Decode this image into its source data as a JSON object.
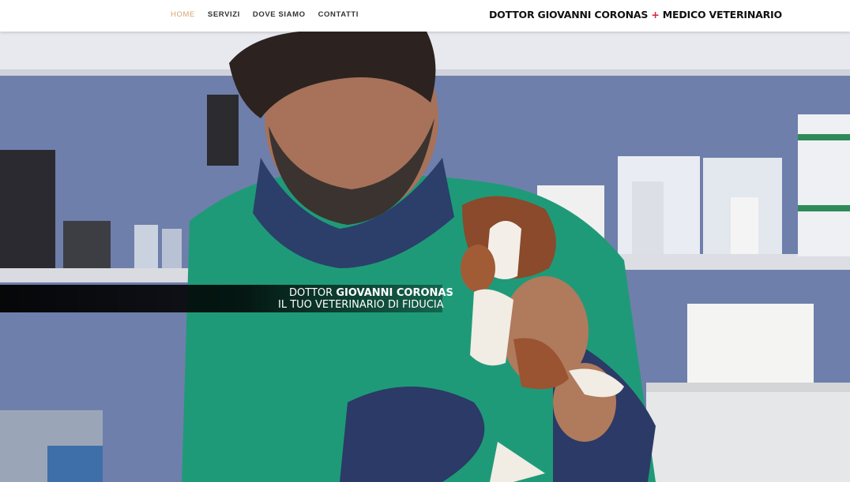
{
  "nav": {
    "items": [
      {
        "label": "HOME",
        "active": true
      },
      {
        "label": "SERVIZI",
        "active": false
      },
      {
        "label": "DOVE SIAMO",
        "active": false
      },
      {
        "label": "CONTATTI",
        "active": false
      }
    ]
  },
  "brand": {
    "part1": "DOTTOR GIOVANNI CORONAS",
    "plus": "+",
    "part2": "MEDICO VETERINARIO"
  },
  "hero": {
    "caption_prefix": "DOTTOR",
    "caption_name": "GIOVANNI CORONAS",
    "caption_line2": "IL TUO VETERINARIO DI FIDUCIA"
  },
  "colors": {
    "nav_active": "#d4a373",
    "brand_plus": "#d9233a",
    "scrubs": "#1f9a78"
  }
}
